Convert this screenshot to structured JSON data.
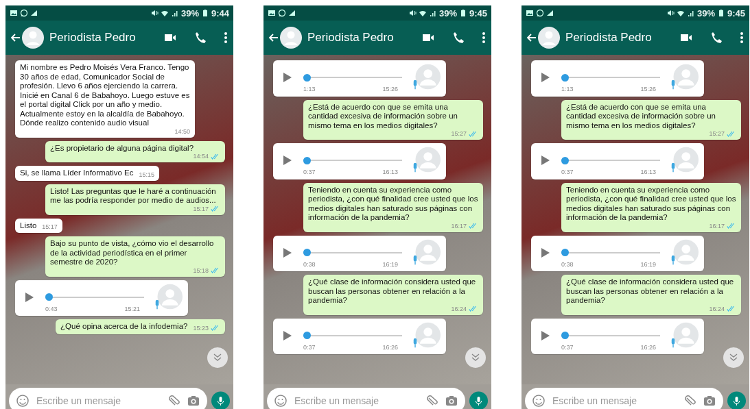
{
  "phones": [
    {
      "status": {
        "battery": "39%",
        "time": "9:44"
      },
      "contact": "Periodista Pedro",
      "messages": [
        {
          "kind": "in",
          "text": "Mi nombre es Pedro Moisés Vera Franco. Tengo 30 años de edad, Comunicador Social de profesión. Llevo 6 años ejerciendo la carrera. Inicié en Canal 6 de Babahoyo. Luego estuve es el portal digital Click por un año y medio. Actualmente estoy en la alcaldía de Babahoyo. Dónde realizo contenido audio visual",
          "time": "14:50"
        },
        {
          "kind": "out",
          "text": "¿Es propietario de alguna página digital?",
          "time": "14:54",
          "read": true
        },
        {
          "kind": "in",
          "text": "Si, se llama Líder Informativo Ec",
          "time": "15:15"
        },
        {
          "kind": "out",
          "text": "Listo! Las preguntas que le haré a continuación me las podría responder por medio de audios...",
          "time": "15:17",
          "read": true
        },
        {
          "kind": "in",
          "text": "Listo",
          "time": "15:17"
        },
        {
          "kind": "out",
          "text": "Bajo su punto de vista, ¿cómo vio el desarrollo de la actividad periodística en el primer semestre de 2020?",
          "time": "15:18",
          "read": true
        },
        {
          "kind": "audio",
          "duration": "0:43",
          "time": "15:21",
          "level": 0
        },
        {
          "kind": "out",
          "text": "¿Qué opina acerca de la infodemia?",
          "time": "15:23",
          "read": true
        }
      ],
      "scroll_button": true,
      "input": {
        "placeholder": "Escribe un mensaje"
      }
    },
    {
      "status": {
        "battery": "39%",
        "time": "9:45"
      },
      "contact": "Periodista Pedro",
      "messages": [
        {
          "kind": "audio",
          "duration": "1:13",
          "time": "15:26",
          "level": 0
        },
        {
          "kind": "out",
          "text": "¿Está de acuerdo con que se emita una cantidad excesiva de información sobre un mismo tema en los medios digitales?",
          "time": "15:27",
          "read": true
        },
        {
          "kind": "audio",
          "duration": "0:37",
          "time": "16:13",
          "level": 0
        },
        {
          "kind": "out",
          "text": "Teniendo en cuenta su experiencia como periodista, ¿con qué finalidad cree usted que los medios digitales han saturado sus páginas con información de la pandemia?",
          "time": "16:17",
          "read": true
        },
        {
          "kind": "audio",
          "duration": "0:38",
          "time": "16:19",
          "level": 0
        },
        {
          "kind": "out",
          "text": "¿Qué clase de información considera usted que buscan las personas obtener en relación a la pandemia?",
          "time": "16:24",
          "read": true
        },
        {
          "kind": "audio",
          "duration": "0:37",
          "time": "16:26",
          "level": 0
        }
      ],
      "scroll_button": true,
      "input": {
        "placeholder": "Escribe un mensaje"
      }
    },
    {
      "status": {
        "battery": "39%",
        "time": "9:45"
      },
      "contact": "Periodista Pedro",
      "messages": [
        {
          "kind": "audio",
          "duration": "1:13",
          "time": "15:26",
          "level": 0
        },
        {
          "kind": "out",
          "text": "¿Está de acuerdo con que se emita una cantidad excesiva de información sobre un mismo tema en los medios digitales?",
          "time": "15:27",
          "read": true
        },
        {
          "kind": "audio",
          "duration": "0:37",
          "time": "16:13",
          "level": 0
        },
        {
          "kind": "out",
          "text": "Teniendo en cuenta su experiencia como periodista, ¿con qué finalidad cree usted que los medios digitales han saturado sus páginas con información de la pandemia?",
          "time": "16:17",
          "read": true
        },
        {
          "kind": "audio",
          "duration": "0:38",
          "time": "16:19",
          "level": 0
        },
        {
          "kind": "out",
          "text": "¿Qué clase de información considera usted que buscan las personas obtener en relación a la pandemia?",
          "time": "16:24",
          "read": true
        },
        {
          "kind": "audio",
          "duration": "0:37",
          "time": "16:26",
          "level": 0
        }
      ],
      "scroll_button": true,
      "input": {
        "placeholder": "Escribe un mensaje"
      }
    }
  ]
}
